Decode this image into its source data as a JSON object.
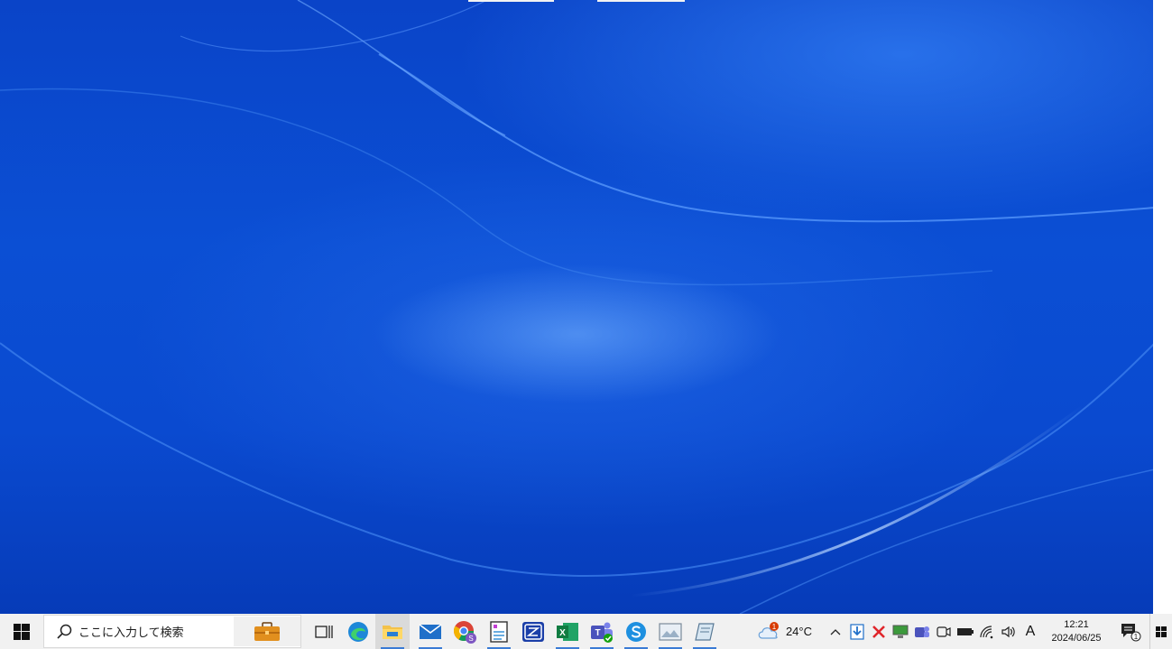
{
  "taskbar": {
    "search_placeholder": "ここに入力して検索",
    "pinned_apps": [
      {
        "name": "task-view",
        "running": false,
        "active": false
      },
      {
        "name": "edge",
        "running": false,
        "active": false
      },
      {
        "name": "file-explorer",
        "running": true,
        "active": true
      },
      {
        "name": "mail",
        "running": true,
        "active": false
      },
      {
        "name": "chrome",
        "running": false,
        "active": false
      },
      {
        "name": "notepad-app",
        "running": true,
        "active": false
      },
      {
        "name": "zoho-app",
        "running": false,
        "active": false
      },
      {
        "name": "excel",
        "running": true,
        "active": false
      },
      {
        "name": "teams",
        "running": true,
        "active": false
      },
      {
        "name": "skype",
        "running": true,
        "active": false
      },
      {
        "name": "photos-app",
        "running": true,
        "active": false
      },
      {
        "name": "notebook-app",
        "running": true,
        "active": false
      }
    ]
  },
  "tray": {
    "weather_temp": "24°C",
    "weather_badge": "1",
    "ime_label": "A",
    "time": "12:21",
    "date": "2024/06/25",
    "notification_count": "1"
  },
  "colors": {
    "desktop_blue": "#0a4ad0",
    "taskbar_bg": "#f1f1f1",
    "accent": "#3a7bd5"
  }
}
